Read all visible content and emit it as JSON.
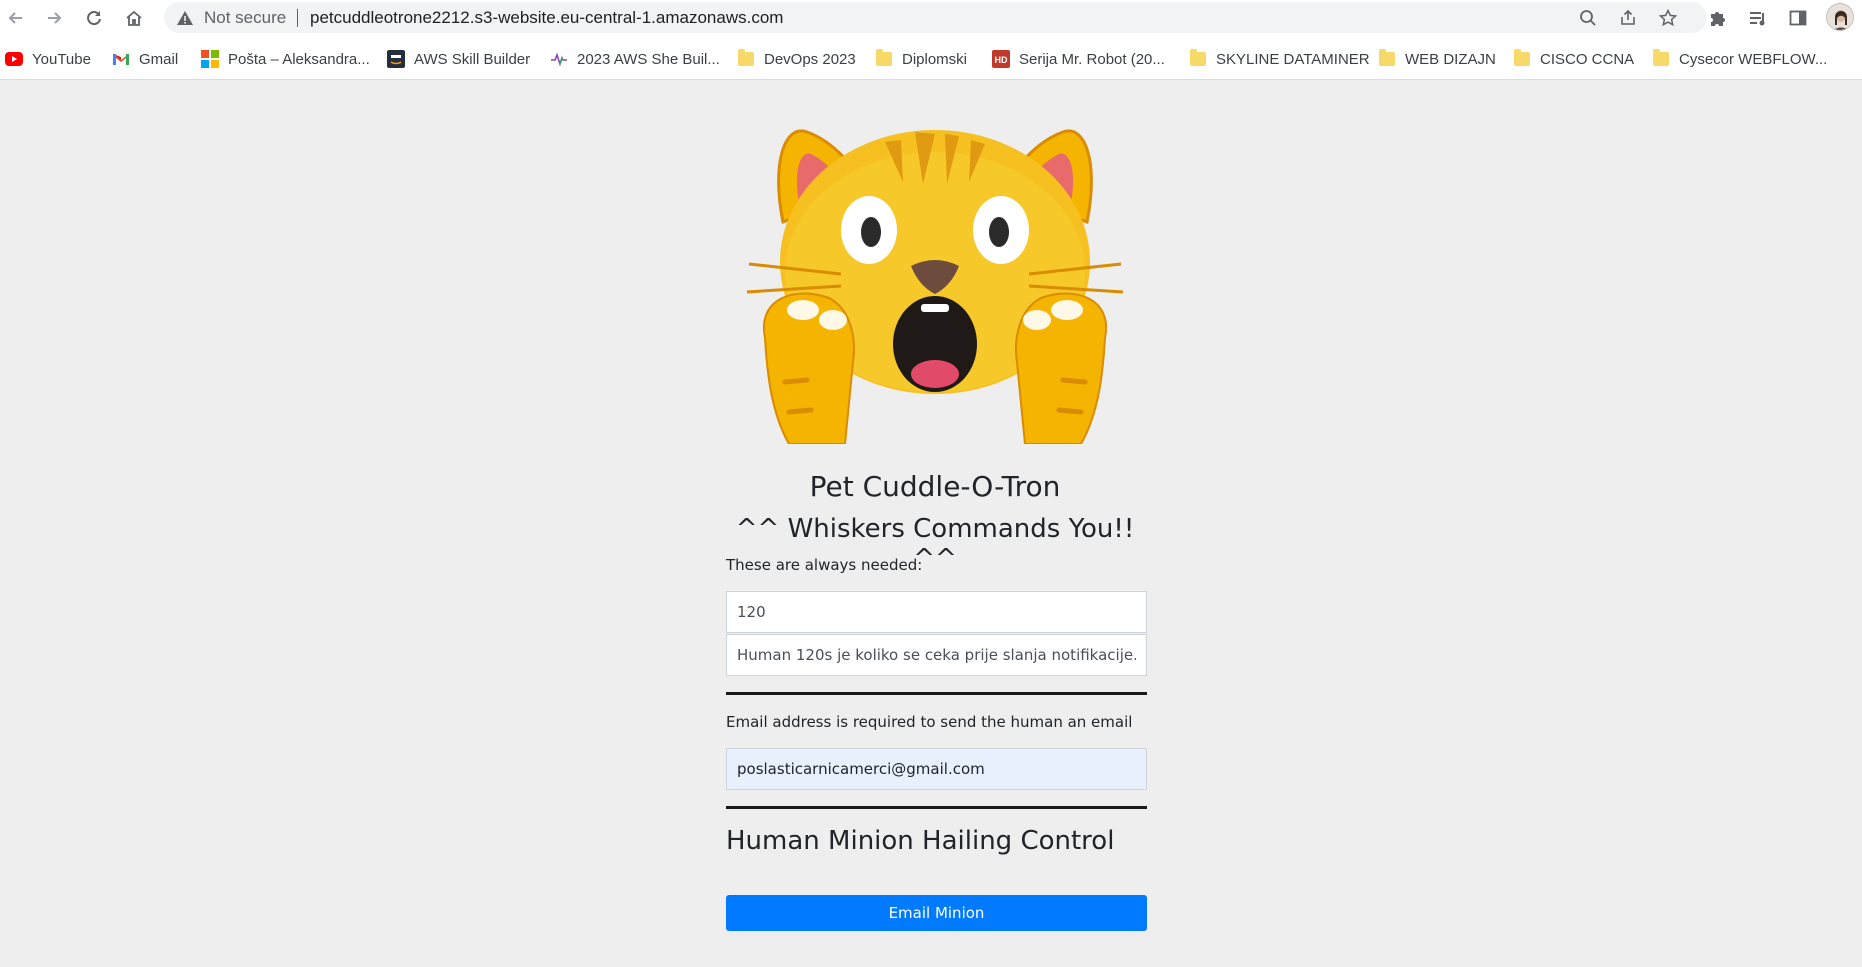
{
  "browser": {
    "security_label": "Not secure",
    "url": "petcuddleotrone2212.s3-website.eu-central-1.amazonaws.com",
    "bookmarks": [
      {
        "label": "YouTube",
        "icon": "youtube-icon"
      },
      {
        "label": "Gmail",
        "icon": "gmail-icon"
      },
      {
        "label": "Pošta – Aleksandra...",
        "icon": "microsoft-icon"
      },
      {
        "label": "AWS Skill Builder",
        "icon": "aws-icon"
      },
      {
        "label": "2023 AWS She Buil...",
        "icon": "pulse-icon"
      },
      {
        "label": "DevOps 2023",
        "icon": "folder-icon"
      },
      {
        "label": "Diplomski",
        "icon": "folder-icon"
      },
      {
        "label": "Serija Mr. Robot (20...",
        "icon": "hd-icon"
      },
      {
        "label": "SKYLINE DATAMINER",
        "icon": "folder-icon"
      },
      {
        "label": "WEB DIZAJN",
        "icon": "folder-icon"
      },
      {
        "label": "CISCO CCNA",
        "icon": "folder-icon"
      },
      {
        "label": "Cysecor WEBFLOW...",
        "icon": "folder-icon"
      }
    ]
  },
  "page": {
    "title": "Pet Cuddle-O-Tron",
    "subtitle": "^^ Whiskers Commands You!! ^^",
    "always_needed_label": "These are always needed:",
    "wait_seconds_value": "120",
    "message_value": "Human 120s je koliko se ceka prije slanja notifikacije.",
    "email_label": "Email address is required to send the human an email",
    "email_value": "poslasticarnicamerci@gmail.com",
    "control_heading": "Human Minion Hailing Control",
    "email_button": "Email Minion",
    "hero_image": "screaming-cat-emoji-icon"
  },
  "colors": {
    "page_bg": "#eeeeee",
    "primary_button": "#007bff",
    "autofill_bg": "#e8f0fe"
  }
}
